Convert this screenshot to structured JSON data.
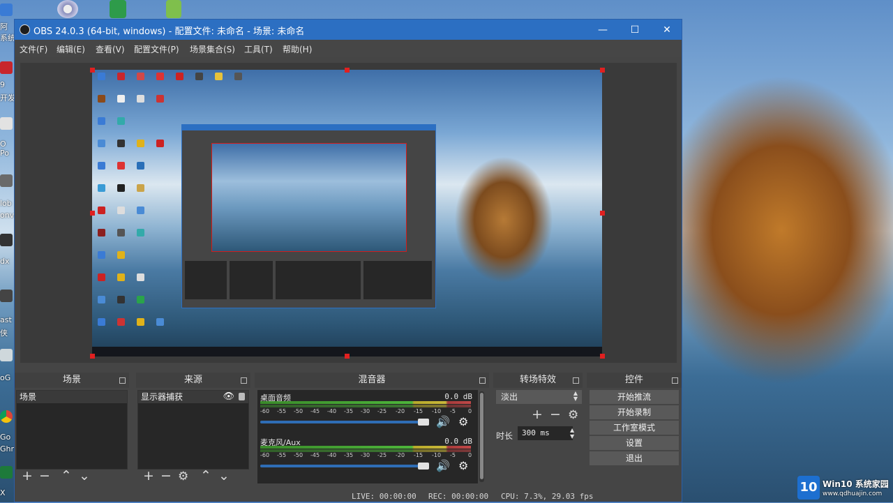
{
  "window": {
    "title": "OBS 24.0.3 (64-bit, windows) - 配置文件: 未命名 - 场景: 未命名",
    "controls": {
      "minimize": "—",
      "maximize": "☐",
      "close": "✕"
    }
  },
  "menu": [
    "文件(F)",
    "编辑(E)",
    "查看(V)",
    "配置文件(P)",
    "场景集合(S)",
    "工具(T)",
    "帮助(H)"
  ],
  "docks": {
    "scenes": {
      "title": "场景",
      "items": [
        "场景"
      ]
    },
    "sources": {
      "title": "来源",
      "items": [
        "显示器捕获"
      ]
    },
    "mixer": {
      "title": "混音器",
      "channels": [
        {
          "name": "桌面音频",
          "level": "0.0 dB",
          "volume": 1.0
        },
        {
          "name": "麦克风/Aux",
          "level": "0.0 dB",
          "volume": 1.0
        }
      ],
      "scale": [
        "-60",
        "-55",
        "-50",
        "-45",
        "-40",
        "-35",
        "-30",
        "-25",
        "-20",
        "-15",
        "-10",
        "-5",
        "0"
      ]
    },
    "transitions": {
      "title": "转场特效",
      "selected": "淡出",
      "duration_label": "时长",
      "duration_value": "300 ms"
    },
    "controls": {
      "title": "控件",
      "buttons": [
        "开始推流",
        "开始录制",
        "工作室模式",
        "设置",
        "退出"
      ]
    }
  },
  "status": {
    "live": "LIVE: 00:00:00",
    "rec": "REC: 00:00:00",
    "cpu": "CPU: 7.3%, 29.03 fps"
  },
  "desktop_fragments": [
    "阿",
    "系统",
    "P",
    "9",
    "开发",
    "O Po",
    "lob",
    "onv",
    "dx",
    "ast",
    "侠",
    "oG",
    "Go",
    "Ghr",
    "X"
  ],
  "watermark": {
    "logo": "10",
    "title": "Win10 系统家园",
    "url": "www.qdhuajin.com"
  },
  "colors": {
    "titlebar": "#2c6fc2",
    "panel": "#454545",
    "selection": "#e02020",
    "meter_green": "#4db53a"
  }
}
